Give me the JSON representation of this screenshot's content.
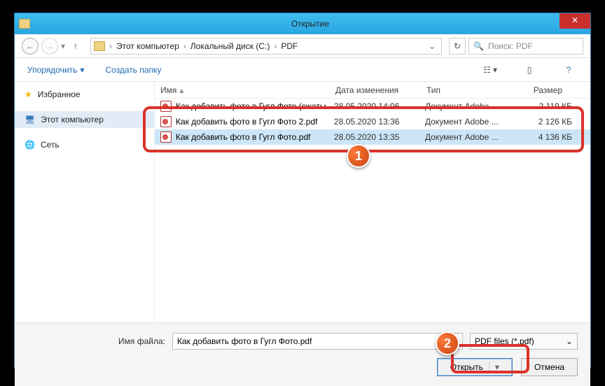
{
  "title": "Открытие",
  "nav": {
    "crumbs": [
      "Этот компьютер",
      "Локальный диск (C:)",
      "PDF"
    ],
    "search_placeholder": "Поиск: PDF"
  },
  "toolbar": {
    "organize": "Упорядочить",
    "newfolder": "Создать папку"
  },
  "sidebar": {
    "favorites": "Избранное",
    "computer": "Этот компьютер",
    "network": "Сеть"
  },
  "columns": {
    "name": "Имя",
    "date": "Дата изменения",
    "type": "Тип",
    "size": "Размер"
  },
  "files": [
    {
      "name": "Как добавить фото в Гугл Фото (сжаты...",
      "date": "28.05.2020 14:06",
      "type": "Документ Adobe ...",
      "size": "2 119 КБ"
    },
    {
      "name": "Как добавить фото в Гугл Фото 2.pdf",
      "date": "28.05.2020 13:36",
      "type": "Документ Adobe ...",
      "size": "2 126 КБ"
    },
    {
      "name": "Как добавить фото в Гугл Фото.pdf",
      "date": "28.05.2020 13:35",
      "type": "Документ Adobe ...",
      "size": "4 136 КБ"
    }
  ],
  "footer": {
    "filename_label": "Имя файла:",
    "filename_value": "Как добавить фото в Гугл Фото.pdf",
    "filter": "PDF files (*.pdf)",
    "open": "Открыть",
    "cancel": "Отмена"
  },
  "badges": {
    "one": "1",
    "two": "2"
  }
}
